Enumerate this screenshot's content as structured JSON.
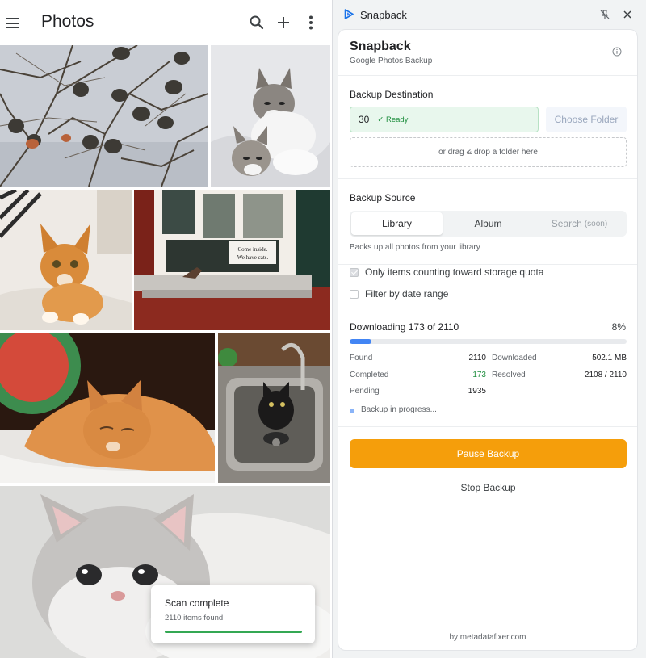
{
  "photos_app": {
    "title": "Photos",
    "icons": [
      "menu-icon",
      "search-icon",
      "add-icon",
      "more-vert-icon"
    ],
    "toast": {
      "title": "Scan complete",
      "subtitle": "2110 items found",
      "progress_fraction": 1.0,
      "progress_color": "#34a853"
    },
    "photo_overlay_text": [
      "Come inside.",
      "We have cats."
    ]
  },
  "extension": {
    "window_title": "Snapback",
    "app_title": "Snapback",
    "app_subtitle": "Google Photos Backup",
    "destination": {
      "label": "Backup Destination",
      "value": "30",
      "status": "✓ Ready",
      "choose_label": "Choose Folder",
      "drop_hint": "or drag & drop a folder here"
    },
    "source": {
      "label": "Backup Source",
      "tabs": [
        {
          "label": "Library",
          "suffix": ""
        },
        {
          "label": "Album",
          "suffix": ""
        },
        {
          "label": "Search",
          "suffix": "(soon)"
        }
      ],
      "selected_tab": "Library",
      "description": "Backs up all photos from your library"
    },
    "options": {
      "quota_label": "Only items counting toward storage quota",
      "quota_checked": true,
      "date_filter_label": "Filter by date range",
      "date_filter_checked": false
    },
    "download": {
      "title": "Downloading 173 of 2110",
      "percent_text": "8%",
      "progress_fraction": 0.08,
      "stats": {
        "found_label": "Found",
        "found_value": "2110",
        "downloaded_label": "Downloaded",
        "downloaded_value": "502.1 MB",
        "completed_label": "Completed",
        "completed_value": "173",
        "resolved_label": "Resolved",
        "resolved_value": "2108 / 2110",
        "pending_label": "Pending",
        "pending_value": "1935"
      },
      "status_text": "Backup in progress..."
    },
    "pause_label": "Pause Backup",
    "stop_label": "Stop Backup",
    "footer": "by metadatafixer.com"
  },
  "colors": {
    "accent_orange": "#f59e0b",
    "progress_blue": "#4285f4",
    "ready_green": "#1e8e3e",
    "ready_bg": "#e8f7ed"
  }
}
